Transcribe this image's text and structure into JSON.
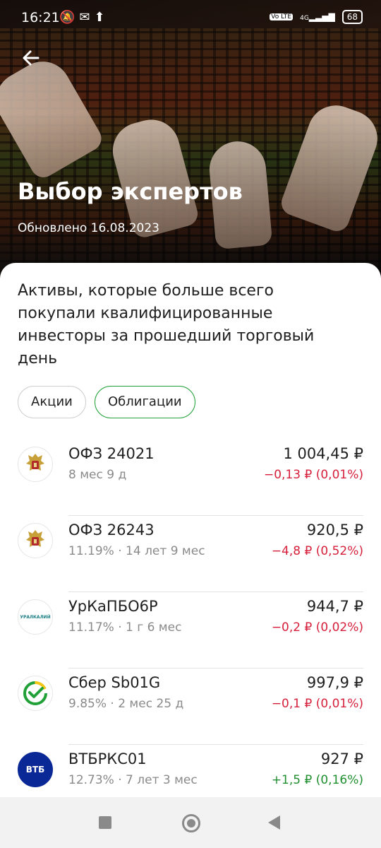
{
  "status_bar": {
    "time": "16:21",
    "battery": "68",
    "network": "4G",
    "volte": "Vo LTE"
  },
  "header": {
    "title": "Выбор экспертов",
    "updated": "Обновлено 16.08.2023"
  },
  "description": "Активы, которые больше всего покупали квалифицированные инвесторы за прошедший торговый день",
  "filters": [
    {
      "label": "Акции",
      "selected": false
    },
    {
      "label": "Облигации",
      "selected": true
    }
  ],
  "colors": {
    "accent_green": "#21a038",
    "negative": "#d6203b",
    "positive": "#1f8f2f"
  },
  "assets": [
    {
      "name": "ОФЗ 24021",
      "sub": "8 мес 9 д",
      "price": "1 004,45 ₽",
      "change": "−0,13 ₽ (0,01%)",
      "trend": "neg",
      "icon": "russia-emblem-icon"
    },
    {
      "name": "ОФЗ 26243",
      "sub": "11.19% · 14 лет 9 мес",
      "price": "920,5 ₽",
      "change": "−4,8 ₽ (0,52%)",
      "trend": "neg",
      "icon": "russia-emblem-icon"
    },
    {
      "name": "УрКаПБО6Р",
      "sub": "11.17% · 1 г 6 мес",
      "price": "944,7 ₽",
      "change": "−0,2 ₽ (0,02%)",
      "trend": "neg",
      "icon": "uralkali-logo-icon",
      "logo_text": "УРАЛКАЛИЙ"
    },
    {
      "name": "Сбер Sb01G",
      "sub": "9.85% · 2 мес 25 д",
      "price": "997,9 ₽",
      "change": "−0,1 ₽ (0,01%)",
      "trend": "neg",
      "icon": "sber-logo-icon"
    },
    {
      "name": "ВТБРКС01",
      "sub": "12.73% · 7 лет 3 мес",
      "price": "927 ₽",
      "change": "+1,5 ₽ (0,16%)",
      "trend": "pos",
      "icon": "vtb-logo-icon",
      "logo_text": "ВТБ"
    }
  ]
}
